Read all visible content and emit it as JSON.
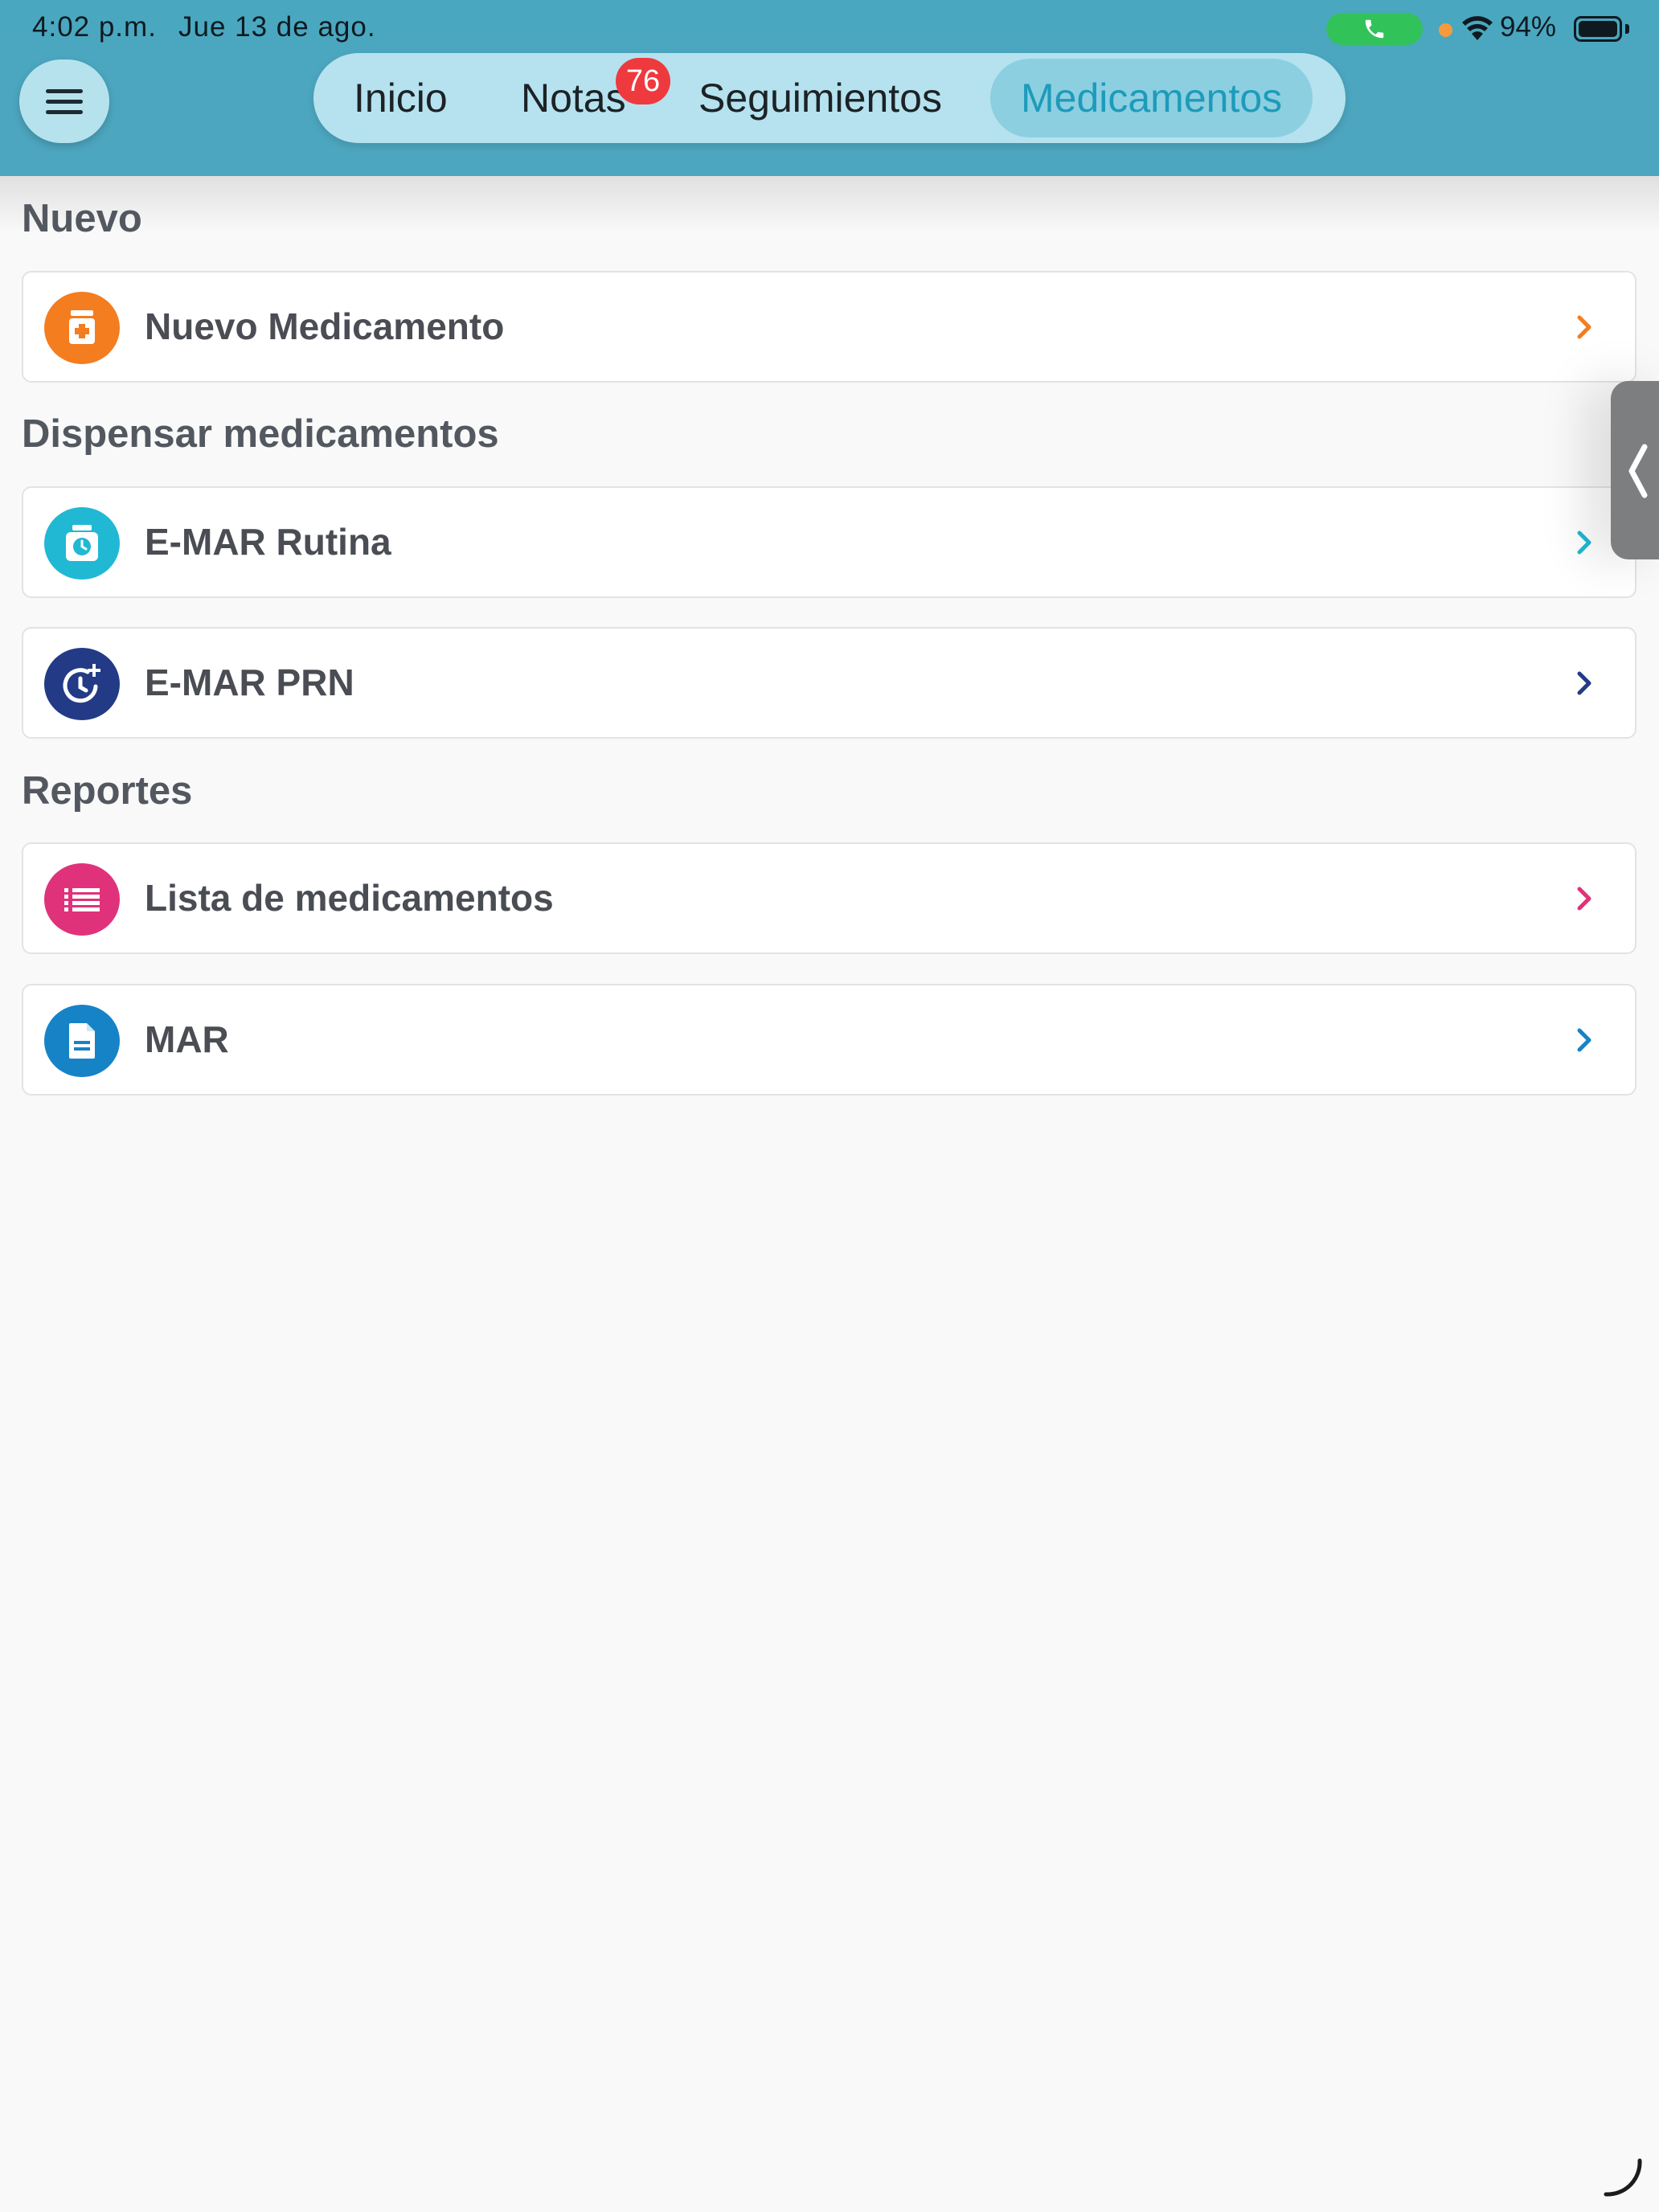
{
  "status_bar": {
    "time": "4:02 p.m.",
    "date": "Jue 13 de ago.",
    "battery": "94%",
    "battery_level": 0.94
  },
  "nav": {
    "tabs": [
      {
        "label": "Inicio"
      },
      {
        "label": "Notas",
        "badge": "76"
      },
      {
        "label": "Seguimientos"
      },
      {
        "label": "Medicamentos",
        "active": true
      }
    ]
  },
  "sections": {
    "nuevo": "Nuevo",
    "dispensar": "Dispensar medicamentos",
    "reportes": "Reportes"
  },
  "items": {
    "nuevo_medicamento": {
      "label": "Nuevo Medicamento",
      "icon": "medicine-bottle-icon",
      "color": "#f47d20"
    },
    "emar_rutina": {
      "label": "E-MAR Rutina",
      "icon": "medicine-clock-icon",
      "color": "#21b8d4"
    },
    "emar_prn": {
      "label": "E-MAR PRN",
      "icon": "clock-plus-icon",
      "color": "#233b86"
    },
    "lista_medicamentos": {
      "label": "Lista de medicamentos",
      "icon": "list-icon",
      "color": "#e0327b"
    },
    "mar": {
      "label": "MAR",
      "icon": "document-icon",
      "color": "#1783c7"
    }
  },
  "colors": {
    "header": "#4aa7c0",
    "tab_active_text": "#1d9bbb",
    "badge": "#ee3a3e",
    "background": "#f9f9f9"
  }
}
